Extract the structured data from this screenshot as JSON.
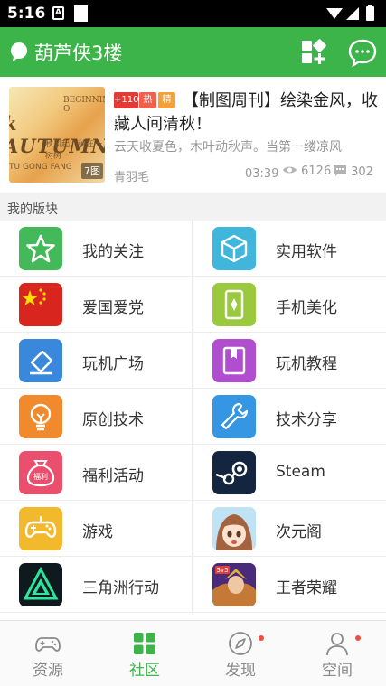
{
  "status_bar": {
    "time": "5:16",
    "notif_letter": "A"
  },
  "app_bar": {
    "title": "葫芦侠3楼",
    "accent": "#3cb44a"
  },
  "featured_post": {
    "thumb": {
      "line1": "BEGINNING O",
      "line2": "k AUTUMN",
      "line3": "秋风起，秋在一树树",
      "line4": "TU GONG FANG",
      "image_count": "7图"
    },
    "tags": [
      {
        "text": "+110",
        "color": "#e53935"
      },
      {
        "text": "热",
        "color": "#f0604c"
      },
      {
        "text": "精",
        "color": "#f4a13a"
      }
    ],
    "title": "【制图周刊】绘染金风，收藏人间清秋！",
    "excerpt": "云天收夏色，木叶动秋声。当第一缕凉风",
    "author": "青羽毛",
    "time": "03:39",
    "views": "6126",
    "comments": "302"
  },
  "section": {
    "title": "我的版块"
  },
  "boards": [
    {
      "label": "我的关注",
      "icon": "star-icon",
      "color": "#43b95a"
    },
    {
      "label": "实用软件",
      "icon": "cube-icon",
      "color": "#40b6dd"
    },
    {
      "label": "爱国爱党",
      "icon": "china-flag-icon",
      "color": "#d8261f"
    },
    {
      "label": "手机美化",
      "icon": "phone-icon",
      "color": "#9bc93d"
    },
    {
      "label": "玩机广场",
      "icon": "eraser-icon",
      "color": "#3a88db"
    },
    {
      "label": "玩机教程",
      "icon": "book-icon",
      "color": "#b04ecf"
    },
    {
      "label": "原创技术",
      "icon": "lightbulb-icon",
      "color": "#f08a2c"
    },
    {
      "label": "技术分享",
      "icon": "wrench-icon",
      "color": "#3596e3"
    },
    {
      "label": "福利活动",
      "icon": "money-bag-icon",
      "color": "#ea4f6d"
    },
    {
      "label": "Steam",
      "icon": "steam-icon",
      "color": "#14253f"
    },
    {
      "label": "游戏",
      "icon": "gamepad-icon",
      "color": "#f3b92c"
    },
    {
      "label": "次元阁",
      "icon": "anime-avatar-icon",
      "color": "#f6d5c2"
    },
    {
      "label": "三角洲行动",
      "icon": "delta-force-icon",
      "color": "#0e1a1d"
    },
    {
      "label": "王者荣耀",
      "icon": "honor-of-kings-icon",
      "color": "#7a3ab0"
    }
  ],
  "bottom_nav": [
    {
      "label": "资源",
      "icon": "gamepad-outline-icon",
      "active": false
    },
    {
      "label": "社区",
      "icon": "grid-four-icon",
      "active": true
    },
    {
      "label": "发现",
      "icon": "compass-icon",
      "active": false
    },
    {
      "label": "空间",
      "icon": "person-icon",
      "active": false
    }
  ]
}
